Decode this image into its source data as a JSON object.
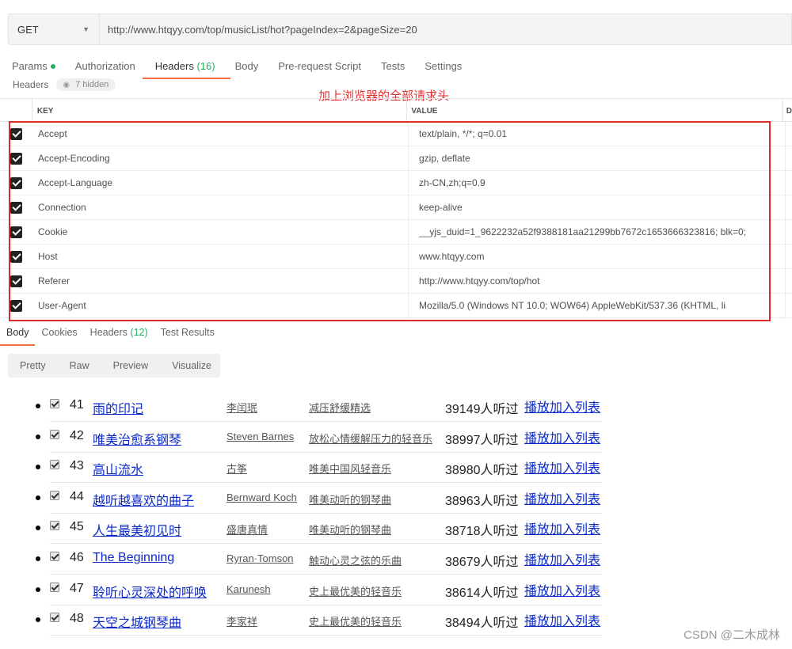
{
  "request": {
    "method": "GET",
    "url": "http://www.htqyy.com/top/musicList/hot?pageIndex=2&pageSize=20"
  },
  "request_tabs": {
    "params": "Params",
    "authorization": "Authorization",
    "headers": "Headers",
    "headers_count": "(16)",
    "body": "Body",
    "prerequest": "Pre-request Script",
    "tests": "Tests",
    "settings": "Settings"
  },
  "headers_sub": {
    "label": "Headers",
    "hidden": "7 hidden"
  },
  "annotation": "加上浏览器的全部请求头",
  "table": {
    "key_header": "KEY",
    "value_header": "VALUE",
    "extra_header": "D",
    "rows": [
      {
        "key": "Accept",
        "value": "text/plain, */*; q=0.01"
      },
      {
        "key": "Accept-Encoding",
        "value": "gzip, deflate"
      },
      {
        "key": "Accept-Language",
        "value": "zh-CN,zh;q=0.9"
      },
      {
        "key": "Connection",
        "value": "keep-alive"
      },
      {
        "key": "Cookie",
        "value": "__yjs_duid=1_9622232a52f9388181aa21299bb7672c1653666323816; blk=0;"
      },
      {
        "key": "Host",
        "value": "www.htqyy.com"
      },
      {
        "key": "Referer",
        "value": "http://www.htqyy.com/top/hot"
      },
      {
        "key": "User-Agent",
        "value": "Mozilla/5.0 (Windows NT 10.0; WOW64) AppleWebKit/537.36 (KHTML, li"
      }
    ]
  },
  "response_tabs": {
    "body": "Body",
    "cookies": "Cookies",
    "headers": "Headers",
    "headers_count": "(12)",
    "test_results": "Test Results"
  },
  "modes": [
    "Pretty",
    "Raw",
    "Preview",
    "Visualize"
  ],
  "songs": [
    {
      "num": "41",
      "title": "雨的印记",
      "artist": "李闰珉",
      "album": "减压舒缓精选",
      "plays": "39149人听过",
      "actions": "播放加入列表"
    },
    {
      "num": "42",
      "title": "唯美治愈系钢琴",
      "artist": "Steven Barnes",
      "album": "放松心情缓解压力的轻音乐",
      "plays": "38997人听过",
      "actions": "播放加入列表"
    },
    {
      "num": "43",
      "title": "高山流水",
      "artist": "古筝",
      "album": "唯美中国风轻音乐",
      "plays": "38980人听过",
      "actions": "播放加入列表"
    },
    {
      "num": "44",
      "title": "越听越喜欢的曲子",
      "artist": "Bernward Koch",
      "album": "唯美动听的钢琴曲",
      "plays": "38963人听过",
      "actions": "播放加入列表"
    },
    {
      "num": "45",
      "title": "人生最美初见时",
      "artist": "盛唐真情",
      "album": "唯美动听的钢琴曲",
      "plays": "38718人听过",
      "actions": "播放加入列表"
    },
    {
      "num": "46",
      "title": "The Beginning",
      "artist": "Ryran·Tomson",
      "album": "触动心灵之弦的乐曲",
      "plays": "38679人听过",
      "actions": "播放加入列表"
    },
    {
      "num": "47",
      "title": "聆听心灵深处的呼唤",
      "artist": "Karunesh",
      "album": "史上最优美的轻音乐",
      "plays": "38614人听过",
      "actions": "播放加入列表"
    },
    {
      "num": "48",
      "title": "天空之城钢琴曲",
      "artist": "李家祥",
      "album": "史上最优美的轻音乐",
      "plays": "38494人听过",
      "actions": "播放加入列表"
    }
  ],
  "watermark": "CSDN @二木成林"
}
